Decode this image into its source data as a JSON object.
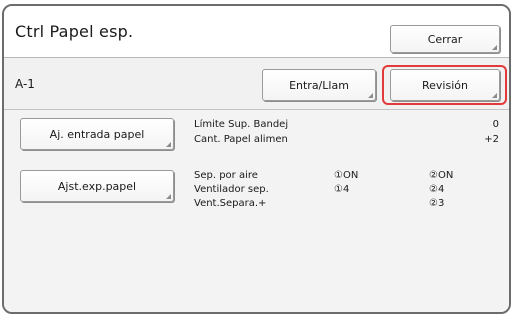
{
  "window": {
    "title": "Ctrl Papel esp.",
    "close_label": "Cerrar"
  },
  "profile": {
    "id": "A-1",
    "entry_label": "Entra/Llam",
    "review_label": "Revisión"
  },
  "feed": {
    "button_label": "Aj. entrada papel",
    "rows": [
      {
        "label": "Límite Sup. Bandej",
        "value": "0"
      },
      {
        "label": "Cant. Papel alimen",
        "value": "+2"
      }
    ]
  },
  "ejection": {
    "button_label": "Ajst.exp.papel",
    "rows": [
      {
        "label": "Sep. por aire",
        "col1": "①ON",
        "col2": "②ON"
      },
      {
        "label": "Ventilador sep.",
        "col1": "①4",
        "col2": "②4"
      },
      {
        "label": "Vent.Separa.+",
        "col1": "",
        "col2": "②3"
      }
    ]
  },
  "colors": {
    "highlight": "#e23a3a"
  }
}
